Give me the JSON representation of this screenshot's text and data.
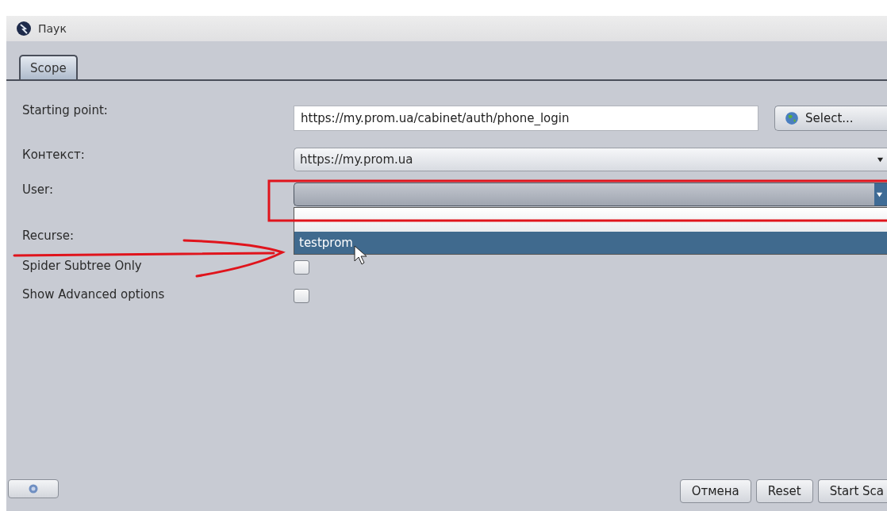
{
  "window": {
    "title": "Паук"
  },
  "tabs": [
    {
      "label": "Scope",
      "selected": true
    }
  ],
  "starting_point": {
    "label": "Starting point:",
    "value": "https://my.prom.ua/cabinet/auth/phone_login",
    "button": "Select..."
  },
  "context": {
    "label": "Контекст:",
    "value": "https://my.prom.ua"
  },
  "user": {
    "label": "User:",
    "expanded": true,
    "options": [
      {
        "label": "testprom",
        "selected": true
      }
    ]
  },
  "recurse": {
    "label": "Recurse:"
  },
  "checkboxes": [
    {
      "label": "Spider Subtree Only",
      "checked": false
    },
    {
      "label": "Show Advanced options",
      "checked": false
    }
  ],
  "buttons": [
    "Отмена",
    "Reset",
    "Start Sca"
  ]
}
